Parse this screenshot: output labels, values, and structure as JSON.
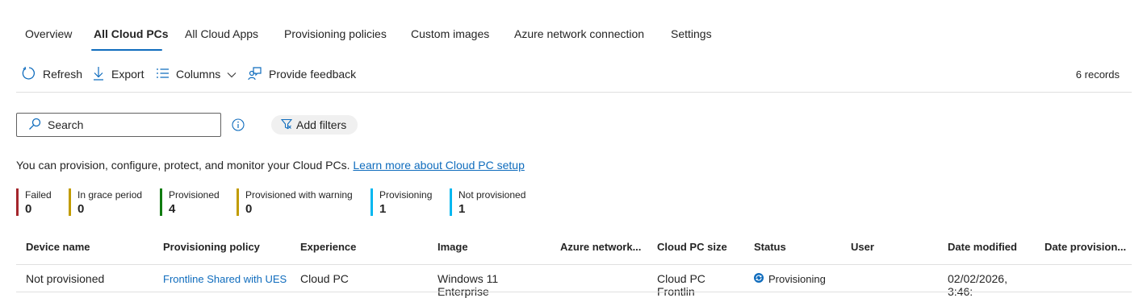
{
  "tabs": [
    {
      "label": "Overview"
    },
    {
      "label": "All Cloud PCs",
      "active": true
    },
    {
      "label": "All Cloud Apps"
    },
    {
      "label": "Provisioning policies"
    },
    {
      "label": "Custom images"
    },
    {
      "label": "Azure network connection"
    },
    {
      "label": "Settings"
    }
  ],
  "toolbar": {
    "refresh": "Refresh",
    "export": "Export",
    "columns": "Columns",
    "feedback": "Provide feedback",
    "records": "6 records"
  },
  "search": {
    "placeholder": "Search",
    "value": ""
  },
  "filters": {
    "add_label": "Add filters"
  },
  "description": {
    "text": "You can provision, configure, protect, and monitor your Cloud PCs.",
    "link": "Learn more about Cloud PC setup"
  },
  "status_summary": [
    {
      "label": "Failed",
      "count": "0",
      "color": "#a4262c"
    },
    {
      "label": "In grace period",
      "count": "0",
      "color": "#c19c00"
    },
    {
      "label": "Provisioned",
      "count": "4",
      "color": "#107c10"
    },
    {
      "label": "Provisioned with warning",
      "count": "0",
      "color": "#c19c00"
    },
    {
      "label": "Provisioning",
      "count": "1",
      "color": "#00b7f0"
    },
    {
      "label": "Not provisioned",
      "count": "1",
      "color": "#00b7f0"
    }
  ],
  "table": {
    "columns": [
      "Device name",
      "Provisioning policy",
      "Experience",
      "Image",
      "Azure network...",
      "Cloud PC size",
      "Status",
      "User",
      "Date modified",
      "Date provision..."
    ],
    "rows": [
      {
        "device_name": "Not provisioned",
        "policy": "Frontline Shared with UES",
        "experience": "Cloud PC",
        "image": "Windows 11 Enterprise",
        "network": "",
        "size": "Cloud PC Frontlin",
        "status": "Provisioning",
        "user": "",
        "date_modified": "02/02/2026, 3:46:",
        "date_provisioned": ""
      }
    ]
  },
  "colors": {
    "accent": "#0f6cbd",
    "provisioning_icon": "#0f6cbd"
  }
}
